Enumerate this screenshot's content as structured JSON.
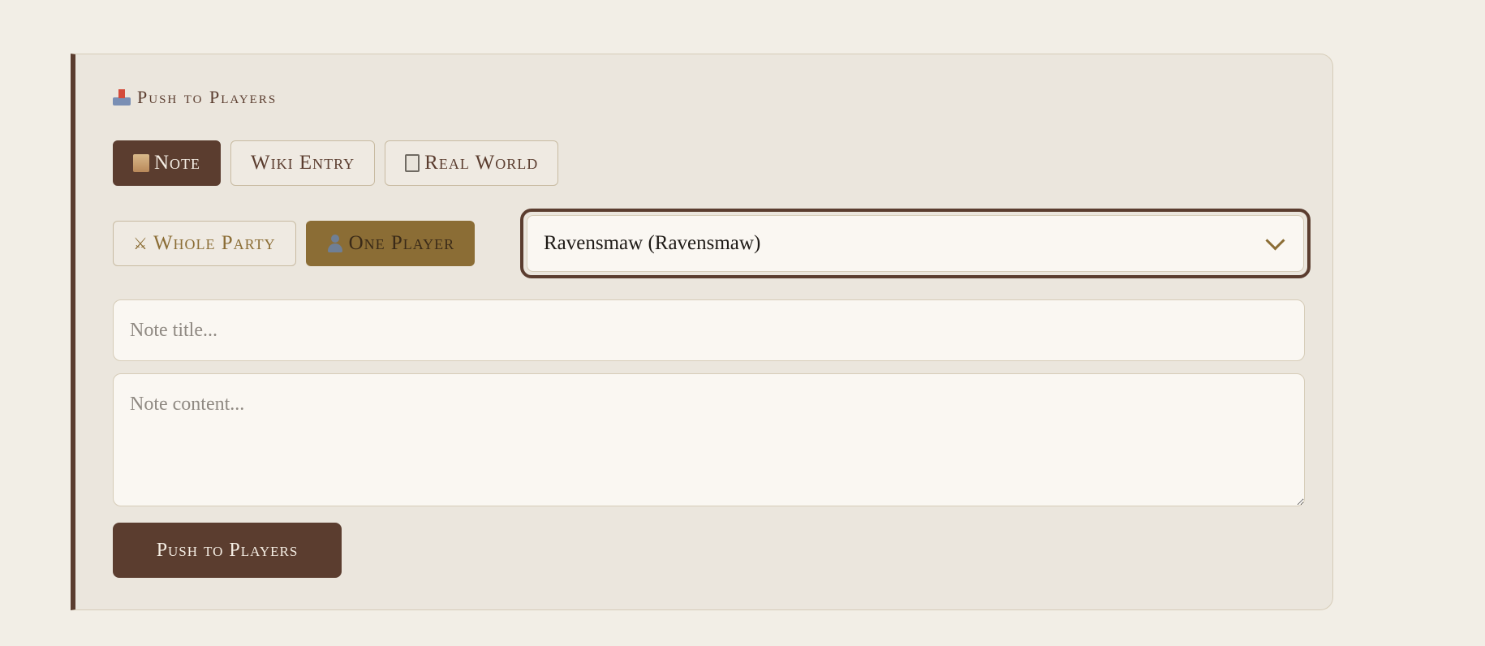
{
  "panel": {
    "title": "Push to Players",
    "icon": "outbox-tray-icon"
  },
  "type_tabs": [
    {
      "label": "Note",
      "icon": "scroll-icon",
      "active": true
    },
    {
      "label": "Wiki Entry",
      "icon": null,
      "active": false
    },
    {
      "label": "Real World",
      "icon": "clipboard-icon",
      "active": false
    }
  ],
  "target_tabs": [
    {
      "label": "Whole Party",
      "icon": "crossed-swords-icon",
      "active": false
    },
    {
      "label": "One Player",
      "icon": "person-icon",
      "active": true
    }
  ],
  "player_select": {
    "selected": "Ravensmaw (Ravensmaw)"
  },
  "note": {
    "title_placeholder": "Note title...",
    "content_placeholder": "Note content..."
  },
  "submit_label": "Push to Players",
  "colors": {
    "accent_brown": "#5b3d2f",
    "accent_gold": "#8b6d35",
    "panel_bg": "#ebe6dd",
    "page_bg": "#f2eee6"
  }
}
